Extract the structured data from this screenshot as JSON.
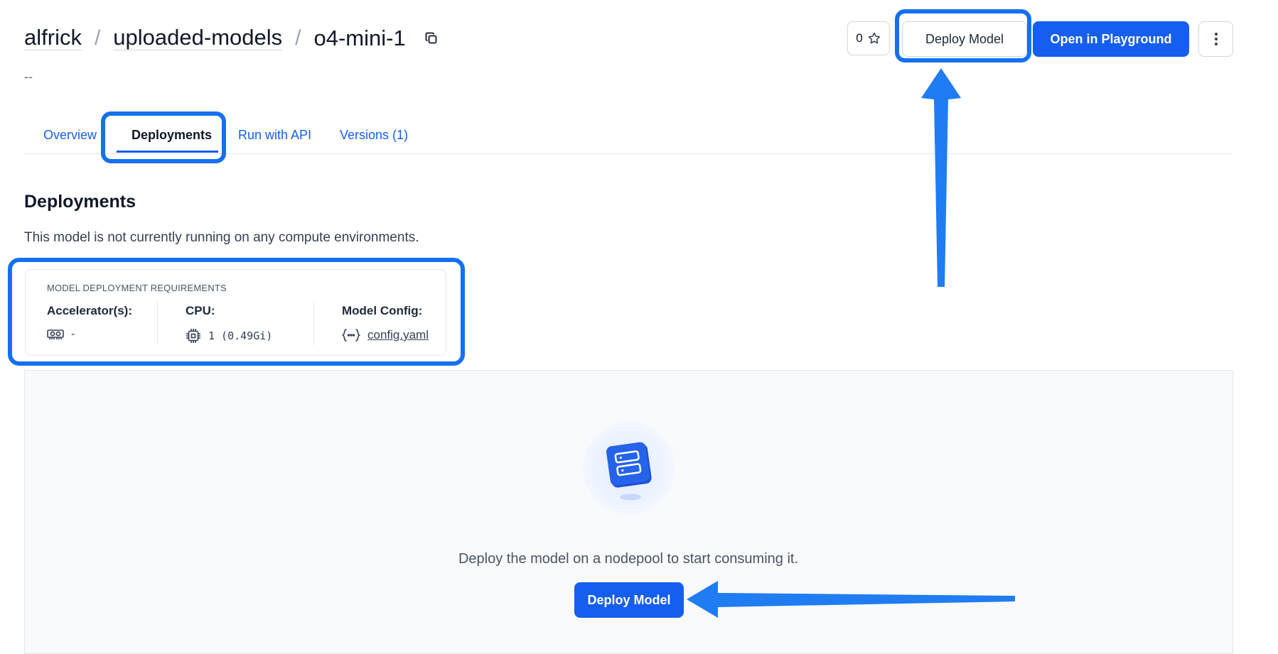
{
  "breadcrumb": {
    "owner": "alfrick",
    "app": "uploaded-models",
    "model": "o4-mini-1",
    "separator": "/"
  },
  "description": "--",
  "header_actions": {
    "star_count": "0",
    "deploy_label": "Deploy Model",
    "playground_label": "Open in Playground"
  },
  "tabs": [
    {
      "label": "Overview"
    },
    {
      "label": "Deployments",
      "active": true
    },
    {
      "label": "Run with API"
    },
    {
      "label": "Versions (1)"
    }
  ],
  "deployments": {
    "title": "Deployments",
    "subtitle": "This model is not currently running on any compute environments."
  },
  "requirements": {
    "title": "MODEL DEPLOYMENT REQUIREMENTS",
    "accelerator": {
      "label": "Accelerator(s):",
      "value": "-"
    },
    "cpu": {
      "label": "CPU:",
      "value": "1 (0.49Gi)"
    },
    "config": {
      "label": "Model Config:",
      "value": "config.yaml"
    }
  },
  "empty_state": {
    "text": "Deploy the model on a nodepool to start consuming it.",
    "button": "Deploy Model"
  },
  "colors": {
    "primary": "#155eef",
    "highlight": "#1570ef",
    "arrow": "#1f7cf2"
  }
}
